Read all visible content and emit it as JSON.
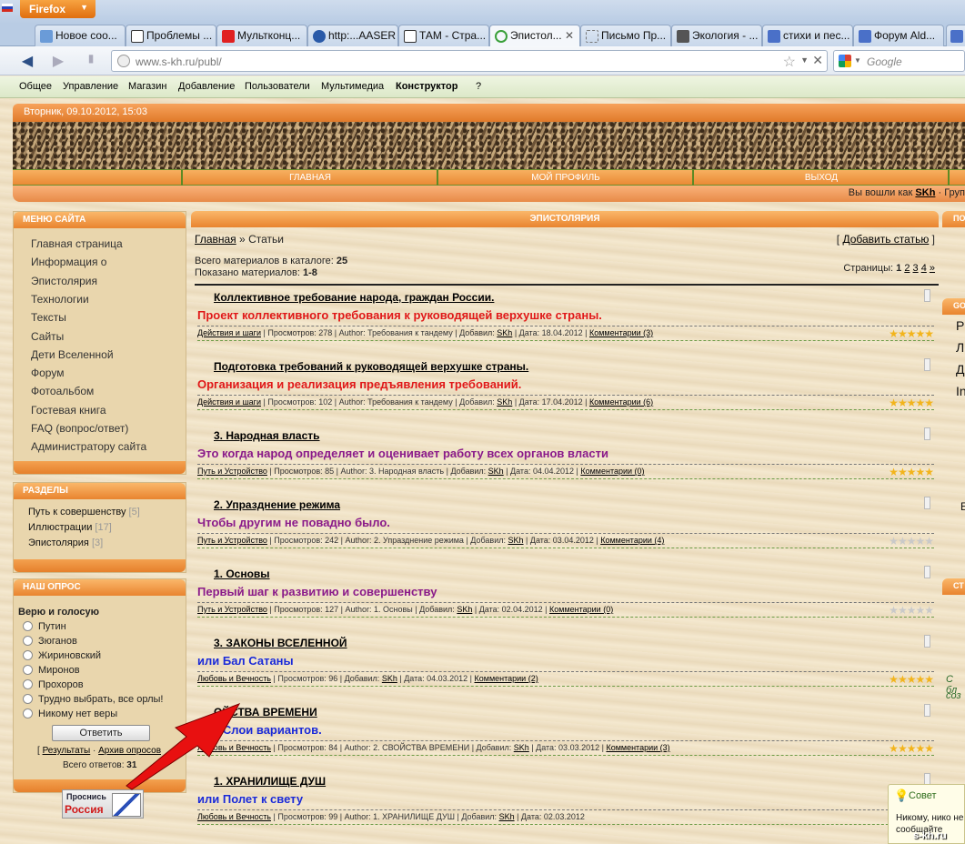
{
  "browser": {
    "app_button": "Firefox",
    "tabs": [
      {
        "label": "Новое соо..."
      },
      {
        "label": "Проблемы ..."
      },
      {
        "label": "Мультконц..."
      },
      {
        "label": "http:...AASER"
      },
      {
        "label": "ТАМ - Стра..."
      },
      {
        "label": "Эпистол...",
        "active": true
      },
      {
        "label": "Письмо Пр..."
      },
      {
        "label": "Экология - ..."
      },
      {
        "label": "стихи и пес..."
      },
      {
        "label": "Форум Ald..."
      }
    ],
    "url": "www.s-kh.ru/publ/",
    "search_placeholder": "Google"
  },
  "admin_bar": [
    "Общее",
    "Управление",
    "Магазин",
    "Добавление",
    "Пользователи",
    "Мультимедиа",
    "Конструктор",
    "?"
  ],
  "site": {
    "date": "Вторник, 09.10.2012, 15:03",
    "main_menu": [
      "ГЛАВНАЯ",
      "МОЙ ПРОФИЛЬ",
      "ВЫХОД"
    ],
    "login_prefix": "Вы вошли как",
    "login_user": "SKh",
    "login_suffix": "· Груп"
  },
  "left": {
    "menu_title": "Меню сайта",
    "menu_items": [
      "Главная страница",
      "Информация о",
      "Эпистолярия",
      "Технологии",
      "Тексты",
      "Сайты",
      "Дети Вселенной",
      "Форум",
      "Фотоальбом",
      "Гостевая книга",
      "FAQ (вопрос/ответ)",
      "Администратору сайта"
    ],
    "sections_title": "Разделы",
    "sections": [
      {
        "name": "Путь к совершенству",
        "count": "[5]"
      },
      {
        "name": "Иллюстрации",
        "count": "[17]"
      },
      {
        "name": "Эпистолярия",
        "count": "[3]"
      }
    ],
    "poll_title": "Наш опрос",
    "poll_question": "Верю и голосую",
    "poll_options": [
      "Путин",
      "Зюганов",
      "Жириновский",
      "Миронов",
      "Прохоров",
      "Трудно выбрать, все орлы!",
      "Никому нет веры"
    ],
    "vote_button": "Ответить",
    "results_link": "Результаты",
    "archive_link": "Архив опросов",
    "total_votes_label": "Всего ответов:",
    "total_votes": "31",
    "logo_text_1": "Проснись",
    "logo_text_2": "Россия"
  },
  "content": {
    "title": "Эпистолярия",
    "breadcrumb_home": "Главная",
    "breadcrumb_sep": "»",
    "breadcrumb_current": "Статьи",
    "add_article": "Добавить статью",
    "total_label": "Всего материалов в каталоге:",
    "total_value": "25",
    "shown_label": "Показано материалов:",
    "shown_value": "1-8",
    "pages_label": "Страницы:",
    "pages": [
      "1",
      "2",
      "3",
      "4",
      "»"
    ],
    "entries": [
      {
        "title": "Коллективное требование народа, граждан России.",
        "subtitle": "Проект коллективного требования к руководящей верхушке страны.",
        "subtitle_color": "#e01818",
        "category": "Действия и шаги",
        "views": "Просмотров: 278",
        "author": "Author: Требования к тандему",
        "added_by": "SKh",
        "date": "Дата: 18.04.2012",
        "comments": "Комментарии (3)",
        "rating": 5
      },
      {
        "title": "Подготовка требований к руководящей верхушке страны.",
        "subtitle": "Организация и реализация предъявления требований.",
        "subtitle_color": "#e01818",
        "category": "Действия и шаги",
        "views": "Просмотров: 102",
        "author": "Author: Требования к тандему",
        "added_by": "SKh",
        "date": "Дата: 17.04.2012",
        "comments": "Комментарии (6)",
        "rating": 5
      },
      {
        "title": "3. Народная власть",
        "subtitle": "Это когда народ определяет и оценивает работу всех органов власти",
        "subtitle_color": "#8a1a8a",
        "category": "Путь и Устройство",
        "views": "Просмотров: 85",
        "author": "Author: 3. Народная власть",
        "added_by": "SKh",
        "date": "Дата: 04.04.2012",
        "comments": "Комментарии (0)",
        "rating": 5
      },
      {
        "title": "2. Упразднение режима",
        "subtitle": "Чтобы другим не повадно было.",
        "subtitle_color": "#8a1a8a",
        "category": "Путь и Устройство",
        "views": "Просмотров: 242",
        "author": "Author: 2. Упразднение режима",
        "added_by": "SKh",
        "date": "Дата: 03.04.2012",
        "comments": "Комментарии (4)",
        "rating": 0
      },
      {
        "title": "1. Основы",
        "subtitle": "Первый шаг к развитию и совершенству",
        "subtitle_color": "#8a1a8a",
        "category": "Путь и Устройство",
        "views": "Просмотров: 127",
        "author": "Author: 1. Основы",
        "added_by": "SKh",
        "date": "Дата: 02.04.2012",
        "comments": "Комментарии (0)",
        "rating": 0
      },
      {
        "title": "3. ЗАКОНЫ ВСЕЛЕННОЙ",
        "subtitle": "или Бал Сатаны",
        "subtitle_color": "#1a2ad8",
        "category": "Любовь и Вечность",
        "views": "Просмотров: 96",
        "author": "",
        "added_by": "SKh",
        "date": "Дата: 04.03.2012",
        "comments": "Комментарии (2)",
        "rating": 5
      },
      {
        "title": "ОЙСТВА ВРЕМЕНИ",
        "subtitle": "или Слои вариантов.",
        "subtitle_color": "#1a2ad8",
        "category": "Любовь и Вечность",
        "views": "Просмотров: 84",
        "author": "Author: 2. СВОЙСТВА ВРЕМЕНИ",
        "added_by": "SKh",
        "date": "Дата: 03.03.2012",
        "comments": "Комментарии (3)",
        "rating": 5
      },
      {
        "title": "1. ХРАНИЛИЩЕ ДУШ",
        "subtitle": "или Полет к свету",
        "subtitle_color": "#1a2ad8",
        "category": "Любовь и Вечность",
        "views": "Просмотров: 99",
        "author": "Author: 1. ХРАНИЛИЩЕ ДУШ",
        "added_by": "SKh",
        "date": "Дата: 02.03.2012",
        "comments": "",
        "rating": 5
      }
    ],
    "added_label": "Добавил:"
  },
  "right": {
    "head1": "ПО",
    "head2": "GO",
    "head3": "СТ",
    "letters": [
      "P",
      "Л",
      "Д",
      "In"
    ],
    "letter_e": "E",
    "italic1": "С бл",
    "italic2": "соз"
  },
  "tip": {
    "title": "Совет",
    "body": "Никому, нико не сообщайте"
  },
  "watermark": "s-kh.ru",
  "colors": {
    "orange": "#e9842f",
    "accent_green": "#5d8a24",
    "star_gold": "#f2b41c",
    "star_grey": "#c9c9c9"
  }
}
